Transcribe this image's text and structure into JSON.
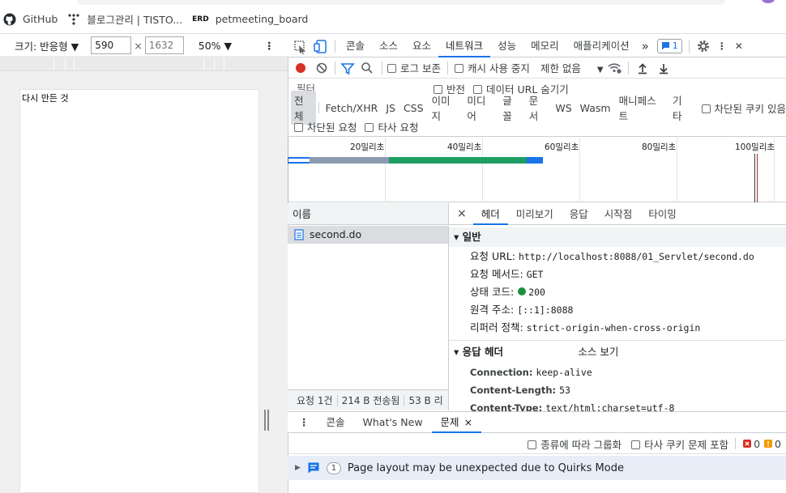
{
  "bookmarks": [
    {
      "label": "GitHub",
      "icon": "github-icon"
    },
    {
      "label": "블로그관리 | TISTO...",
      "icon": "tistory-icon"
    },
    {
      "label": "petmeeting_board",
      "icon": "erd-icon",
      "icon_text": "ERD"
    }
  ],
  "device_toolbar": {
    "size_label": "크기: 반응형 ▼",
    "width": "590",
    "times": "×",
    "height_placeholder": "1632",
    "zoom": "50% ▼",
    "more": "⋮"
  },
  "page": {
    "text": "다시 만든 것"
  },
  "devtools": {
    "tabs": [
      "콘솔",
      "소스",
      "요소",
      "네트워크",
      "성능",
      "메모리",
      "애플리케이션"
    ],
    "active_tab": "네트워크",
    "more_tabs": "»",
    "issues_count": "1",
    "menu": "⋮",
    "close": "✕"
  },
  "network_toolbar": {
    "preserve_log": "로그 보존",
    "disable_cache": "캐시 사용 중지",
    "throttle": "제한 없음",
    "throttle_arrow": "▼"
  },
  "filter": {
    "placeholder": "필터",
    "invert": "반전",
    "hide_data_urls": "데이터 URL 숨기기"
  },
  "types": [
    "전체",
    "Fetch/XHR",
    "JS",
    "CSS",
    "이미지",
    "미디어",
    "글꼴",
    "문서",
    "WS",
    "Wasm",
    "매니페스트",
    "기타"
  ],
  "blocked_cookies": "차단된 쿠키 있음",
  "blocked_requests": "차단된 요청",
  "third_party": "타사 요청",
  "timeline_ticks": [
    "20밀리초",
    "40밀리초",
    "60밀리초",
    "80밀리초",
    "100밀리초"
  ],
  "request_list": {
    "header": "이름",
    "rows": [
      {
        "name": "second.do"
      }
    ],
    "summary": [
      "요청 1건",
      "214 B 전송됨",
      "53 B 리"
    ]
  },
  "detail_tabs": {
    "close": "×",
    "tabs": [
      "헤더",
      "미리보기",
      "응답",
      "시작점",
      "타이밍"
    ],
    "active": "헤더"
  },
  "general": {
    "title": "▾ 일반",
    "rows": [
      {
        "k": "요청 URL:",
        "v": "http://localhost:8088/01_Servlet/second.do"
      },
      {
        "k": "요청 메서드:",
        "v": "GET"
      },
      {
        "k": "상태 코드:",
        "v": "200",
        "status_color": "#1e8e3e"
      },
      {
        "k": "원격 주소:",
        "v": "[::1]:8088"
      },
      {
        "k": "리퍼러 정책:",
        "v": "strict-origin-when-cross-origin"
      }
    ]
  },
  "response_headers": {
    "title": "▾ 응답 헤더",
    "view_source": "소스 보기",
    "rows": [
      {
        "k": "Connection:",
        "v": "keep-alive"
      },
      {
        "k": "Content-Length:",
        "v": "53"
      },
      {
        "k": "Content-Type:",
        "v": "text/html;charset=utf-8"
      }
    ]
  },
  "drawer": {
    "menu": "⋮",
    "tabs": [
      "콘솔",
      "What's New",
      "문제"
    ],
    "active": "문제",
    "close": "×"
  },
  "issues": {
    "group_by_kind": "종류에 따라 그룹화",
    "third_party_cookies": "타사 쿠키 문제 포함",
    "errors": "0",
    "warnings": "0",
    "item_count": "1",
    "item_text": "Page layout may be unexpected due to Quirks Mode"
  },
  "colors": {
    "accent": "#1a73e8",
    "record": "#d93025",
    "status_ok": "#1e8e3e"
  }
}
